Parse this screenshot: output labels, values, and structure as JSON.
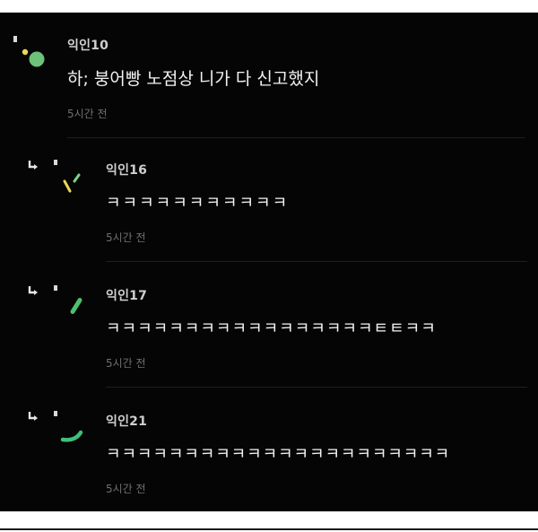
{
  "post_comment": {
    "author": "익인10",
    "text": "하; 붕어빵 노점상 니가 다 신고했지",
    "time": "5시간 전"
  },
  "replies": [
    {
      "author": "익인16",
      "text": "ㅋㅋㅋㅋㅋㅋㅋㅋㅋㅋㅋ",
      "time": "5시간 전",
      "avatar_colors": [
        "#e9d85c",
        "#7fd18b"
      ]
    },
    {
      "author": "익인17",
      "text": "ㅋㅋㅋㅋㅋㅋㅋㅋㅋㅋㅋㅋㅋㅋㅋㅋㅋㅌㅌㅋㅋ",
      "time": "5시간 전",
      "avatar_colors": [
        "#4fc06a"
      ]
    },
    {
      "author": "익인21",
      "text": "ㅋㅋㅋㅋㅋㅋㅋㅋㅋㅋㅋㅋㅋㅋㅋㅋㅋㅋㅋㅋㅋㅋ",
      "time": "5시간 전",
      "avatar_colors": [
        "#3fbf78"
      ]
    }
  ],
  "colors": {
    "background": "#050505",
    "author": "#cfcfcf",
    "text": "#f2f2f2",
    "time": "#6f6f6f",
    "avatar_green": "#6cc27a",
    "avatar_yellow": "#e9d85c"
  },
  "icons": {
    "reply": "reply-arrow-icon",
    "avatar": "anonymous-avatar-icon"
  }
}
